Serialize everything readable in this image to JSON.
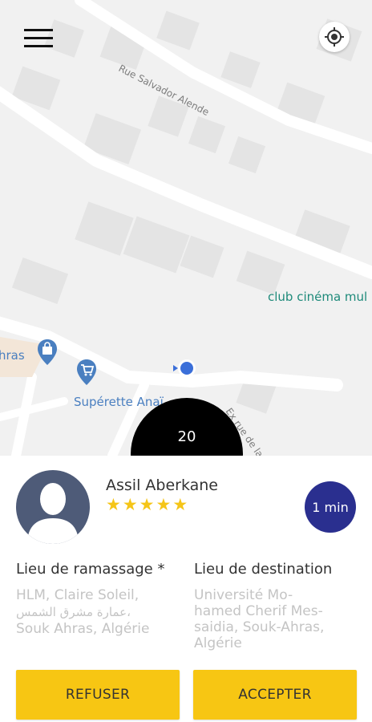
{
  "map": {
    "street_labels": [
      "Rue Salvador Alende",
      "Ex rue de la"
    ],
    "poi_labels": [
      "club cinéma mul",
      "hras",
      "Supérette Anaï"
    ],
    "colors": {
      "background": "#f1f1f1",
      "road": "#ffffff",
      "building": "#e4e4e4",
      "poi_teal": "#1e8a7a",
      "poi_blue": "#4a7fc0",
      "location_dot": "#3b6fd9"
    }
  },
  "header": {
    "menu_icon": "hamburger-menu-icon",
    "locate_icon": "my-location-icon"
  },
  "timer": {
    "value": "20"
  },
  "rider": {
    "name": "Assil Aberkane",
    "rating": 5,
    "stars": [
      "★",
      "★",
      "★",
      "★",
      "★"
    ],
    "eta": "1 min"
  },
  "pickup": {
    "title": "Lieu de ramassage *",
    "lines": [
      "HLM, Claire Soleil,",
      "عمارة مشرق الشمس،",
      "Souk Ahras, Algérie"
    ]
  },
  "destination": {
    "title": "Lieu de destination",
    "lines": [
      "Université Mo-",
      "hamed Cherif Mes-",
      "saidia, Souk-Ahras,",
      "Algérie"
    ]
  },
  "actions": {
    "refuse_label": "REFUSER",
    "accept_label": "ACCEPTER",
    "button_color": "#f7c613",
    "eta_color": "#2a2f8f"
  }
}
